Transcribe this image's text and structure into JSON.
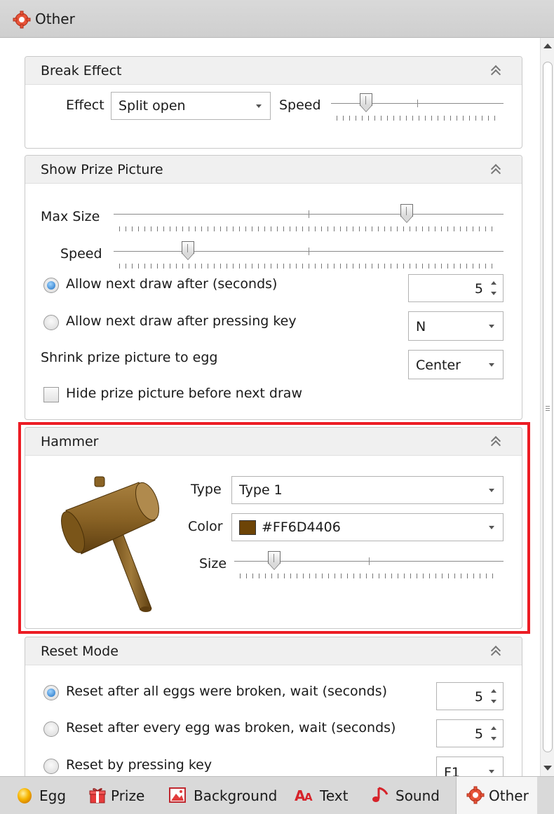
{
  "title": "Other",
  "break_effect": {
    "title": "Break Effect",
    "effect_label": "Effect",
    "effect_value": "Split open",
    "speed_label": "Speed",
    "speed_level": 0.18
  },
  "show_prize": {
    "title": "Show Prize Picture",
    "max_size_label": "Max Size",
    "max_size_level": 0.76,
    "speed_label": "Speed",
    "speed_level": 0.18,
    "allow_after_seconds_label": "Allow next draw after (seconds)",
    "allow_after_seconds_value": "5",
    "allow_after_key_label": "Allow next draw after pressing key",
    "allow_after_key_value": "N",
    "shrink_label": "Shrink prize picture to egg",
    "shrink_value": "Center",
    "hide_label": "Hide prize picture before next draw"
  },
  "hammer": {
    "title": "Hammer",
    "type_label": "Type",
    "type_value": "Type 1",
    "color_label": "Color",
    "color_value": "#FF6D4406",
    "color_swatch": "#6D4406",
    "size_label": "Size",
    "size_level": 0.13
  },
  "reset_mode": {
    "title": "Reset Mode",
    "all_broken_label": "Reset after all eggs were broken, wait (seconds)",
    "all_broken_value": "5",
    "every_broken_label": "Reset after every egg was broken, wait (seconds)",
    "every_broken_value": "5",
    "by_key_label": "Reset by pressing key",
    "by_key_value": "F1"
  },
  "tabs": {
    "egg": "Egg",
    "prize": "Prize",
    "background": "Background",
    "text": "Text",
    "sound": "Sound",
    "other": "Other"
  },
  "icons": [
    "gear-icon",
    "collapse-icon",
    "hammer-icon",
    "egg-icon",
    "prize-icon",
    "background-icon",
    "text-icon",
    "sound-icon"
  ],
  "colors": {
    "highlight": "#EC1C24",
    "selected_radio": "#1D6FC2",
    "hammer_brown": "#6D4406"
  }
}
